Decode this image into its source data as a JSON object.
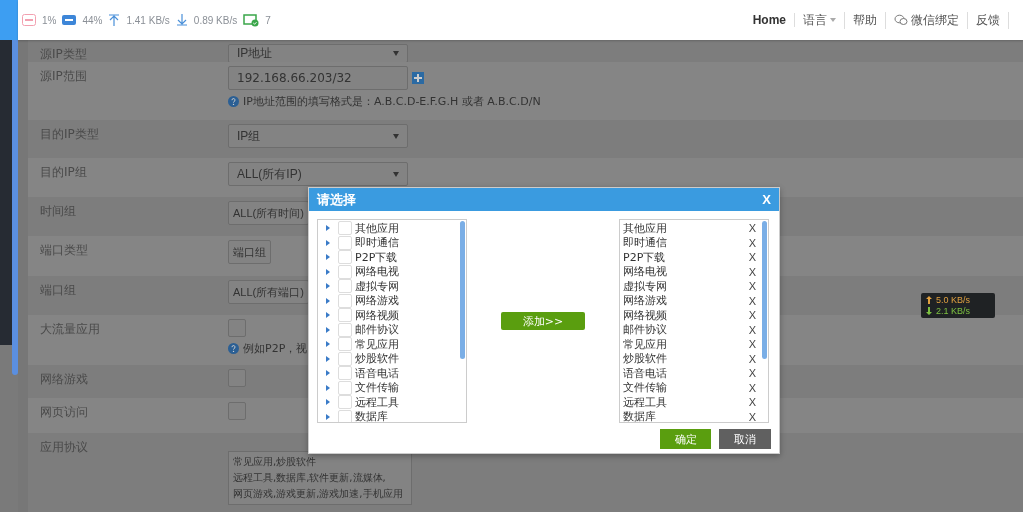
{
  "top_bar": {
    "stats": [
      {
        "kind": "cpu",
        "value": "1%"
      },
      {
        "kind": "ram",
        "value": "44%"
      },
      {
        "kind": "upload",
        "value": "1.41 KB/s"
      },
      {
        "kind": "download",
        "value": "0.89 KB/s"
      },
      {
        "kind": "devices",
        "value": "7"
      }
    ],
    "nav": [
      {
        "kind": "home",
        "label": "Home"
      },
      {
        "kind": "dropdown",
        "label": "语言"
      },
      {
        "kind": "link",
        "label": "帮助"
      },
      {
        "kind": "wechat",
        "label": "微信绑定"
      },
      {
        "kind": "link",
        "label": "反馈"
      }
    ]
  },
  "form": {
    "rows": [
      {
        "label": "源IP类型",
        "kind": "select",
        "value": "IP地址"
      },
      {
        "label": "源IP范围",
        "kind": "input",
        "value": "192.168.66.203/32",
        "help": "IP地址范围的填写格式是：A.B.C.D-E.F.G.H 或者 A.B.C.D/N"
      },
      {
        "label": "目的IP类型",
        "kind": "select",
        "value": "IP组"
      },
      {
        "label": "目的IP组",
        "kind": "select",
        "value": "ALL(所有IP)"
      },
      {
        "label": "时间组",
        "kind": "select",
        "value": "ALL(所有时间)"
      },
      {
        "label": "端口类型",
        "kind": "select",
        "value": "端口组"
      },
      {
        "label": "端口组",
        "kind": "select",
        "value": "ALL(所有端口)"
      },
      {
        "label": "大流量应用",
        "kind": "checkbox",
        "checked": false,
        "help": "例如P2P，视"
      },
      {
        "label": "网络游戏",
        "kind": "checkbox",
        "checked": false
      },
      {
        "label": "网页访问",
        "kind": "checkbox",
        "checked": false
      },
      {
        "label": "应用协议",
        "kind": "textarea",
        "lines": [
          "常见应用,炒股软件",
          "远程工具,数据库,软件更新,流媒体,",
          "网页游戏,游戏更新,游戏加速,手机应用"
        ]
      }
    ]
  },
  "dialog": {
    "title": "请选择",
    "close": "X",
    "available": [
      {
        "label": "其他应用",
        "checked": false
      },
      {
        "label": "即时通信",
        "checked": false
      },
      {
        "label": "P2P下载",
        "checked": false
      },
      {
        "label": "网络电视",
        "checked": false
      },
      {
        "label": "虚拟专网",
        "checked": false
      },
      {
        "label": "网络游戏",
        "checked": false
      },
      {
        "label": "网络视频",
        "checked": false
      },
      {
        "label": "邮件协议",
        "checked": false
      },
      {
        "label": "常见应用",
        "checked": false
      },
      {
        "label": "炒股软件",
        "checked": false
      },
      {
        "label": "语音电话",
        "checked": false
      },
      {
        "label": "文件传输",
        "checked": false
      },
      {
        "label": "远程工具",
        "checked": false
      },
      {
        "label": "数据库",
        "checked": false
      }
    ],
    "add_button": "添加>>",
    "chosen": [
      {
        "label": "其他应用",
        "remove": "X"
      },
      {
        "label": "即时通信",
        "remove": "X"
      },
      {
        "label": "P2P下载",
        "remove": "X"
      },
      {
        "label": "网络电视",
        "remove": "X"
      },
      {
        "label": "虚拟专网",
        "remove": "X"
      },
      {
        "label": "网络游戏",
        "remove": "X"
      },
      {
        "label": "网络视频",
        "remove": "X"
      },
      {
        "label": "邮件协议",
        "remove": "X"
      },
      {
        "label": "常见应用",
        "remove": "X"
      },
      {
        "label": "炒股软件",
        "remove": "X"
      },
      {
        "label": "语音电话",
        "remove": "X"
      },
      {
        "label": "文件传输",
        "remove": "X"
      },
      {
        "label": "远程工具",
        "remove": "X"
      },
      {
        "label": "数据库",
        "remove": "X"
      }
    ],
    "buttons": [
      {
        "kind": "primary",
        "label": "确定"
      },
      {
        "kind": "secondary",
        "label": "取消"
      }
    ]
  },
  "speed_tooltip": {
    "upload": "5.0 KB/s",
    "download": "2.1 KB/s"
  }
}
